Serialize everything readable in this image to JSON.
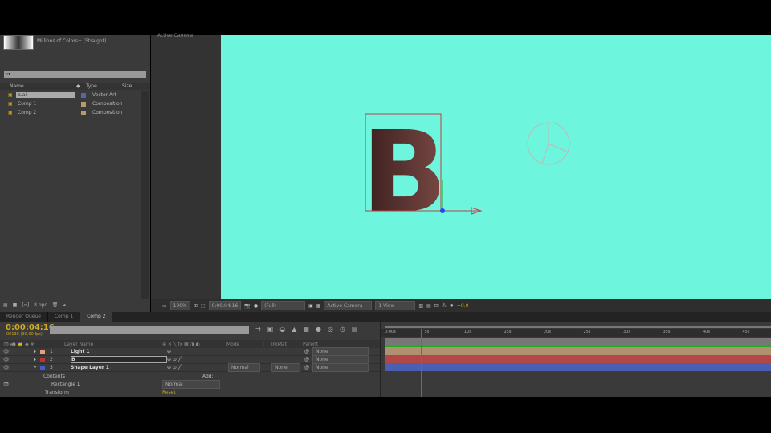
{
  "project": {
    "footage_info": "Millions of Colors+ (Straight)",
    "search_placeholder": "⌕▾",
    "columns": [
      "Name",
      "Type",
      "Size"
    ],
    "items": [
      {
        "name": "b.ai",
        "type": "Vector Art",
        "color": "#5566aa"
      },
      {
        "name": "Comp 1",
        "type": "Composition",
        "color": "#b59a6a"
      },
      {
        "name": "Comp 2",
        "type": "Composition",
        "color": "#b59a6a"
      }
    ],
    "bpc": "8 bpc"
  },
  "comp_panel_label": "Active Camera",
  "viewer": {
    "zoom": "100%",
    "timecode": "0:00:04:16",
    "resolution": "(Full)",
    "camera": "Active Camera",
    "views": "1 View",
    "exposure": "+0.0",
    "background": "#6df5de",
    "letter": "B"
  },
  "tabs": [
    "Render Queue",
    "Comp 1",
    "Comp 2"
  ],
  "timeline": {
    "timecode": "0:00:04:16",
    "frames": "00136 (30.00 fps)",
    "headers": {
      "name": "Layer Name",
      "mode": "Mode",
      "t": "T",
      "trkmat": "TrkMat",
      "parent": "Parent"
    },
    "layers": [
      {
        "num": "1",
        "name": "Light 1",
        "label": "#e8a07a",
        "parent": "None",
        "bar": "#b09070"
      },
      {
        "num": "2",
        "name": "B",
        "label": "#c03030",
        "parent": "None",
        "bar": "#b04848"
      },
      {
        "num": "3",
        "name": "Shape Layer 1",
        "label": "#4060d0",
        "mode": "Normal",
        "trkmat": "None",
        "parent": "None",
        "bar": "#4a5fb0"
      }
    ],
    "contents": "Contents",
    "add": "Add:",
    "rect": "Rectangle 1",
    "rect_mode": "Normal",
    "transform": "Transform",
    "reset": "Reset",
    "ruler": [
      "0:00s",
      "5s",
      "10s",
      "15s",
      "20s",
      "25s",
      "30s",
      "35s",
      "40s",
      "45s"
    ],
    "playhead_seconds": 4.53
  }
}
